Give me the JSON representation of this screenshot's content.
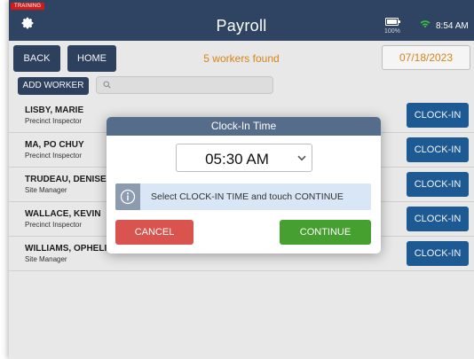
{
  "header": {
    "badge": "TRAINING",
    "title": "Payroll",
    "battery_pct": "100%",
    "time": "8:54 AM",
    "icons": {
      "settings": "gear-icon",
      "battery": "battery-icon",
      "wifi": "wifi-icon"
    }
  },
  "toolbar": {
    "back_label": "BACK",
    "home_label": "HOME",
    "workers_found": "5 workers found",
    "date": "07/18/2023"
  },
  "search": {
    "add_worker_label": "ADD WORKER",
    "value": ""
  },
  "workers": [
    {
      "name": "LISBY, MARIE",
      "role": "Precinct Inspector",
      "action": "CLOCK-IN"
    },
    {
      "name": "MA, PO CHUY",
      "role": "Precinct Inspector",
      "action": "CLOCK-IN"
    },
    {
      "name": "TRUDEAU, DENISE",
      "role": "Site Manager",
      "action": "CLOCK-IN"
    },
    {
      "name": "WALLACE, KEVIN",
      "role": "Precinct Inspector",
      "action": "CLOCK-IN"
    },
    {
      "name": "WILLIAMS, OPHELIA",
      "role": "Site Manager",
      "action": "CLOCK-IN"
    }
  ],
  "modal": {
    "title": "Clock-In Time",
    "selected_time": "05:30 AM",
    "info": "Select CLOCK-IN TIME and touch CONTINUE",
    "cancel_label": "CANCEL",
    "continue_label": "CONTINUE"
  },
  "colors": {
    "header": "#2f4463",
    "accent_orange": "#e08a1a",
    "clockin_blue": "#1f5e9a",
    "cancel_red": "#d9534f",
    "continue_green": "#45a02f",
    "badge_red": "#d11b1b"
  }
}
